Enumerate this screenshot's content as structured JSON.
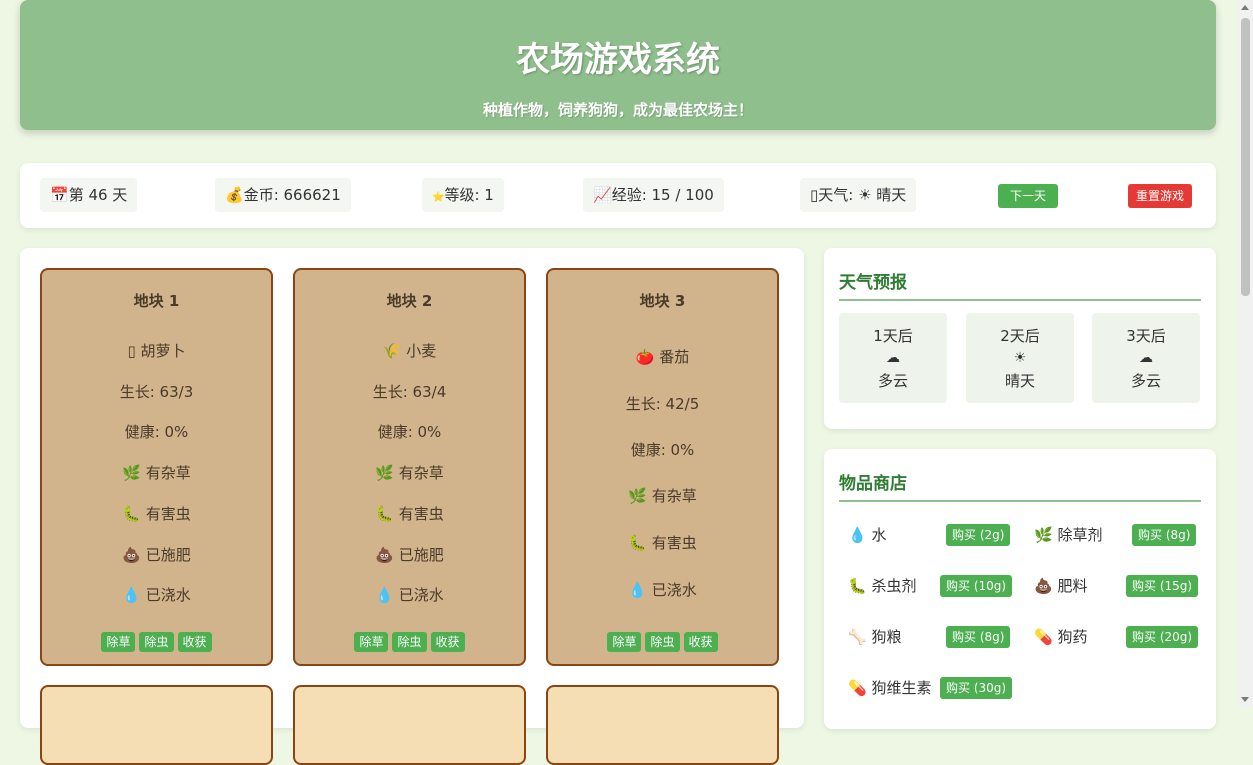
{
  "header": {
    "title": "农场游戏系统",
    "subtitle": "种植作物，饲养狗狗，成为最佳农场主！"
  },
  "status": {
    "day": {
      "icon": "calendar-icon",
      "glyph": "📅",
      "text": "第 46 天"
    },
    "gold": {
      "icon": "money-bag-icon",
      "glyph": "💰",
      "text": "金币: 666621"
    },
    "level": {
      "icon": "star-icon",
      "glyph": "⭐",
      "text": "等级: 1"
    },
    "exp": {
      "icon": "chart-icon",
      "glyph": "📈",
      "text": "经验: 15 / 100"
    },
    "weather": {
      "icon": "weather-icon",
      "glyph": "▯",
      "text": "天气: ☀ 晴天"
    },
    "next_day_label": "下一天",
    "reset_label": "重置游戏"
  },
  "plots": [
    {
      "title": "地块 1",
      "crop": "▯ 胡萝卜",
      "growth": "生长: 63/3",
      "health": "健康: 0%",
      "weeds": "🌿 有杂草",
      "pests": "🐛 有害虫",
      "fertilized": "💩 已施肥",
      "watered": "💧 已浇水"
    },
    {
      "title": "地块 2",
      "crop": "🌾 小麦",
      "growth": "生长: 63/4",
      "health": "健康: 0%",
      "weeds": "🌿 有杂草",
      "pests": "🐛 有害虫",
      "fertilized": "💩 已施肥",
      "watered": "💧 已浇水"
    },
    {
      "title": "地块 3",
      "crop": "🍅 番茄",
      "growth": "生长: 42/5",
      "health": "健康: 0%",
      "weeds": "🌿 有杂草",
      "pests": "🐛 有害虫",
      "watered": "💧 已浇水"
    }
  ],
  "plot_actions": {
    "weed": "除草",
    "pest": "除虫",
    "harvest": "收获"
  },
  "weather_forecast": {
    "title": "天气预报",
    "days": [
      {
        "day": "1天后",
        "icon": "☁",
        "text": "多云"
      },
      {
        "day": "2天后",
        "icon": "☀",
        "text": "晴天"
      },
      {
        "day": "3天后",
        "icon": "☁",
        "text": "多云"
      }
    ]
  },
  "shop": {
    "title": "物品商店",
    "items": [
      {
        "name": "💧 水",
        "buy": "购买 (2g)"
      },
      {
        "name": "🌿 除草剂",
        "buy": "购买 (8g)"
      },
      {
        "name": "🐛 杀虫剂",
        "buy": "购买 (10g)"
      },
      {
        "name": "💩 肥料",
        "buy": "购买 (15g)"
      },
      {
        "name": "🦴 狗粮",
        "buy": "购买 (8g)"
      },
      {
        "name": "💊 狗药",
        "buy": "购买 (20g)"
      },
      {
        "name": "💊 狗维生素",
        "buy": "购买 (30g)"
      }
    ]
  },
  "colors": {
    "header_bg": "#8fbf8c",
    "plot_bg": "#d2b48c",
    "plot_border": "#8b4513",
    "button_green": "#4caf50",
    "button_red": "#e53935",
    "panel_title": "#2e7d32"
  }
}
